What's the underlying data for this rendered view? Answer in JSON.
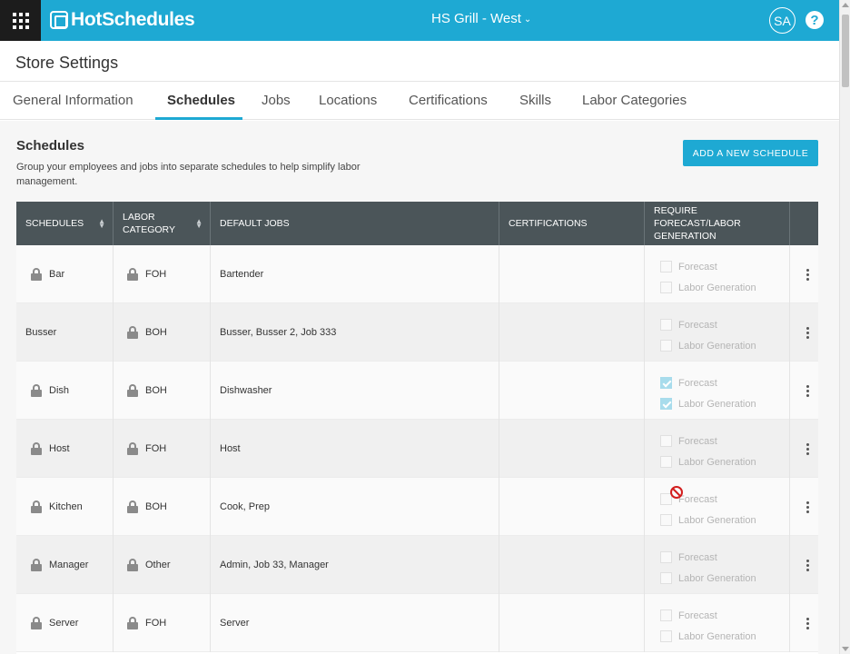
{
  "app": {
    "name": "HotSchedules",
    "store": "HS Grill - West",
    "user_initials": "SA",
    "help_glyph": "?"
  },
  "page": {
    "title": "Store Settings"
  },
  "tabs": [
    {
      "label": "General Information"
    },
    {
      "label": "Schedules"
    },
    {
      "label": "Jobs"
    },
    {
      "label": "Locations"
    },
    {
      "label": "Certifications"
    },
    {
      "label": "Skills"
    },
    {
      "label": "Labor Categories"
    }
  ],
  "section": {
    "title": "Schedules",
    "description": "Group your employees and jobs into separate schedules to help simplify labor management.",
    "add_button": "ADD A NEW SCHEDULE"
  },
  "table": {
    "headers": {
      "schedules": "SCHEDULES",
      "labor_category": "LABOR CATEGORY",
      "default_jobs": "DEFAULT JOBS",
      "certifications": "CERTIFICATIONS",
      "require": "REQUIRE FORECAST/LABOR GENERATION"
    },
    "forecast_label": "Forecast",
    "labor_label": "Labor Generation",
    "rows": [
      {
        "schedule": "Bar",
        "schedule_locked": true,
        "category": "FOH",
        "jobs": "Bartender",
        "certifications": "",
        "forecast": false,
        "labor": false
      },
      {
        "schedule": "Busser",
        "schedule_locked": false,
        "category": "BOH",
        "jobs": "Busser, Busser 2, Job 333",
        "certifications": "",
        "forecast": false,
        "labor": false
      },
      {
        "schedule": "Dish",
        "schedule_locked": true,
        "category": "BOH",
        "jobs": "Dishwasher",
        "certifications": "",
        "forecast": true,
        "labor": true
      },
      {
        "schedule": "Host",
        "schedule_locked": true,
        "category": "FOH",
        "jobs": "Host",
        "certifications": "",
        "forecast": false,
        "labor": false
      },
      {
        "schedule": "Kitchen",
        "schedule_locked": true,
        "category": "BOH",
        "jobs": "Cook, Prep",
        "certifications": "",
        "forecast": false,
        "labor": false
      },
      {
        "schedule": "Manager",
        "schedule_locked": true,
        "category": "Other",
        "jobs": "Admin, Job 33, Manager",
        "certifications": "",
        "forecast": false,
        "labor": false
      },
      {
        "schedule": "Server",
        "schedule_locked": true,
        "category": "FOH",
        "jobs": "Server",
        "certifications": "",
        "forecast": false,
        "labor": false
      }
    ]
  },
  "colors": {
    "brand": "#1ea9d3",
    "header_dark": "#4b5559",
    "checked": "#a8dcec"
  }
}
